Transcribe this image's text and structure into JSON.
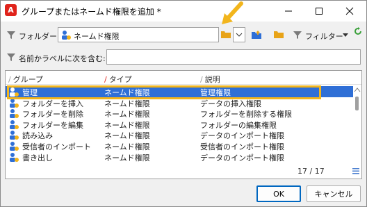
{
  "window": {
    "title": "グループまたはネームド権限を追加 *",
    "logo": "A"
  },
  "toolbar": {
    "folder_label": "フォルダー:",
    "folder_value": "ネームド権限",
    "filter_label": "フィルター"
  },
  "search": {
    "label": "名前かラベルに次を含む:",
    "value": ""
  },
  "list": {
    "columns": [
      "グループ",
      "タイプ",
      "説明"
    ],
    "rows": [
      {
        "name": "管理",
        "type": "ネームド権限",
        "desc": "管理権限",
        "selected": true
      },
      {
        "name": "フォルダーを挿入",
        "type": "ネームド権限",
        "desc": "データの挿入権限",
        "selected": false
      },
      {
        "name": "フォルダーを削除",
        "type": "ネームド権限",
        "desc": "フォルダーを削除する権限",
        "selected": false
      },
      {
        "name": "フォルダーを編集",
        "type": "ネームド権限",
        "desc": "フォルダーの編集権限",
        "selected": false
      },
      {
        "name": "読み込み",
        "type": "ネームド権限",
        "desc": "データのインポート権限",
        "selected": false
      },
      {
        "name": "受信者のインポート",
        "type": "ネームド権限",
        "desc": "受信者のインポート権限",
        "selected": false
      },
      {
        "name": "書き出し",
        "type": "ネームド権限",
        "desc": "データのインポート権限",
        "selected": false
      }
    ],
    "count": "17 / 17"
  },
  "buttons": {
    "ok": "OK",
    "cancel": "キャンセル"
  },
  "colors": {
    "accent": "#2f6fd6",
    "highlight": "#f2b51c",
    "brand": "#e0231b"
  }
}
